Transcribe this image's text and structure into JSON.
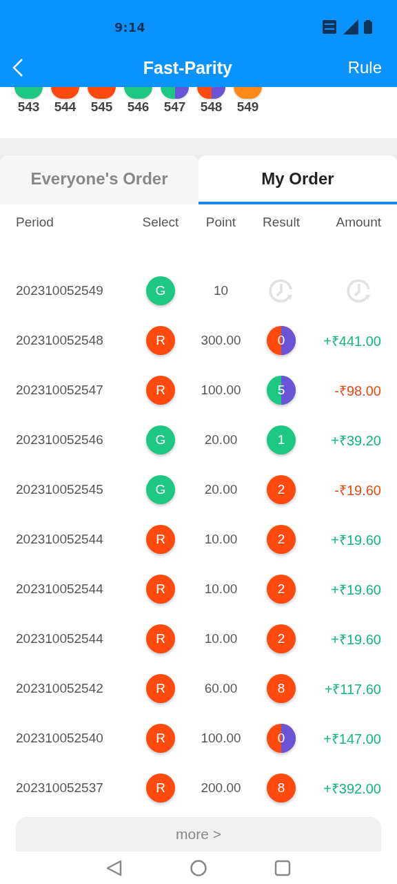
{
  "status_bar": {
    "time": "9:14"
  },
  "header": {
    "title": "Fast-Parity",
    "rule": "Rule"
  },
  "recent": [
    {
      "label": "543",
      "halves": [
        {
          "color": "#1fc784"
        }
      ]
    },
    {
      "label": "544",
      "halves": [
        {
          "color": "#ff4a0f"
        }
      ]
    },
    {
      "label": "545",
      "halves": [
        {
          "color": "#ff4a0f"
        }
      ]
    },
    {
      "label": "546",
      "halves": [
        {
          "color": "#1fc784"
        }
      ]
    },
    {
      "label": "547",
      "halves": [
        {
          "color": "#1fc784"
        },
        {
          "color": "#6a55d8"
        }
      ]
    },
    {
      "label": "548",
      "halves": [
        {
          "color": "#ff4a0f"
        },
        {
          "color": "#6a55d8"
        }
      ]
    },
    {
      "label": "549",
      "halves": [
        {
          "color": "#ff8a1a"
        }
      ]
    }
  ],
  "tabs": [
    {
      "label": "Everyone's Order",
      "selected": false
    },
    {
      "label": "My Order",
      "selected": true
    }
  ],
  "table": {
    "columns": [
      "Period",
      "Select",
      "Point",
      "Result",
      "Amount"
    ],
    "rows": [
      {
        "period": "202310052549",
        "select": {
          "label": "G",
          "color": "#1fc784"
        },
        "point": "10",
        "result": {
          "kind": "pending"
        },
        "amount": {
          "kind": "pending"
        }
      },
      {
        "period": "202310052548",
        "select": {
          "label": "R",
          "color": "#ff4a0f"
        },
        "point": "300.00",
        "result": {
          "kind": "ball",
          "number": "0",
          "halves": [
            {
              "color": "#ff4a0f"
            },
            {
              "color": "#6a55d8"
            }
          ]
        },
        "amount": {
          "kind": "win",
          "text": "+₹441.00"
        }
      },
      {
        "period": "202310052547",
        "select": {
          "label": "R",
          "color": "#ff4a0f"
        },
        "point": "100.00",
        "result": {
          "kind": "ball",
          "number": "5",
          "halves": [
            {
              "color": "#1fc784"
            },
            {
              "color": "#6a55d8"
            }
          ]
        },
        "amount": {
          "kind": "loss",
          "text": "-₹98.00"
        }
      },
      {
        "period": "202310052546",
        "select": {
          "label": "G",
          "color": "#1fc784"
        },
        "point": "20.00",
        "result": {
          "kind": "ball",
          "number": "1",
          "halves": [
            {
              "color": "#1fc784"
            }
          ]
        },
        "amount": {
          "kind": "win",
          "text": "+₹39.20"
        }
      },
      {
        "period": "202310052545",
        "select": {
          "label": "G",
          "color": "#1fc784"
        },
        "point": "20.00",
        "result": {
          "kind": "ball",
          "number": "2",
          "halves": [
            {
              "color": "#ff4a0f"
            }
          ]
        },
        "amount": {
          "kind": "loss",
          "text": "-₹19.60"
        }
      },
      {
        "period": "202310052544",
        "select": {
          "label": "R",
          "color": "#ff4a0f"
        },
        "point": "10.00",
        "result": {
          "kind": "ball",
          "number": "2",
          "halves": [
            {
              "color": "#ff4a0f"
            }
          ]
        },
        "amount": {
          "kind": "win",
          "text": "+₹19.60"
        }
      },
      {
        "period": "202310052544",
        "select": {
          "label": "R",
          "color": "#ff4a0f"
        },
        "point": "10.00",
        "result": {
          "kind": "ball",
          "number": "2",
          "halves": [
            {
              "color": "#ff4a0f"
            }
          ]
        },
        "amount": {
          "kind": "win",
          "text": "+₹19.60"
        }
      },
      {
        "period": "202310052544",
        "select": {
          "label": "R",
          "color": "#ff4a0f"
        },
        "point": "10.00",
        "result": {
          "kind": "ball",
          "number": "2",
          "halves": [
            {
              "color": "#ff4a0f"
            }
          ]
        },
        "amount": {
          "kind": "win",
          "text": "+₹19.60"
        }
      },
      {
        "period": "202310052542",
        "select": {
          "label": "R",
          "color": "#ff4a0f"
        },
        "point": "60.00",
        "result": {
          "kind": "ball",
          "number": "8",
          "halves": [
            {
              "color": "#ff4a0f"
            }
          ]
        },
        "amount": {
          "kind": "win",
          "text": "+₹117.60"
        }
      },
      {
        "period": "202310052540",
        "select": {
          "label": "R",
          "color": "#ff4a0f"
        },
        "point": "100.00",
        "result": {
          "kind": "ball",
          "number": "0",
          "halves": [
            {
              "color": "#ff4a0f"
            },
            {
              "color": "#6a55d8"
            }
          ]
        },
        "amount": {
          "kind": "win",
          "text": "+₹147.00"
        }
      },
      {
        "period": "202310052537",
        "select": {
          "label": "R",
          "color": "#ff4a0f"
        },
        "point": "200.00",
        "result": {
          "kind": "ball",
          "number": "8",
          "halves": [
            {
              "color": "#ff4a0f"
            }
          ]
        },
        "amount": {
          "kind": "win",
          "text": "+₹392.00"
        }
      }
    ]
  },
  "more_button": "more >"
}
